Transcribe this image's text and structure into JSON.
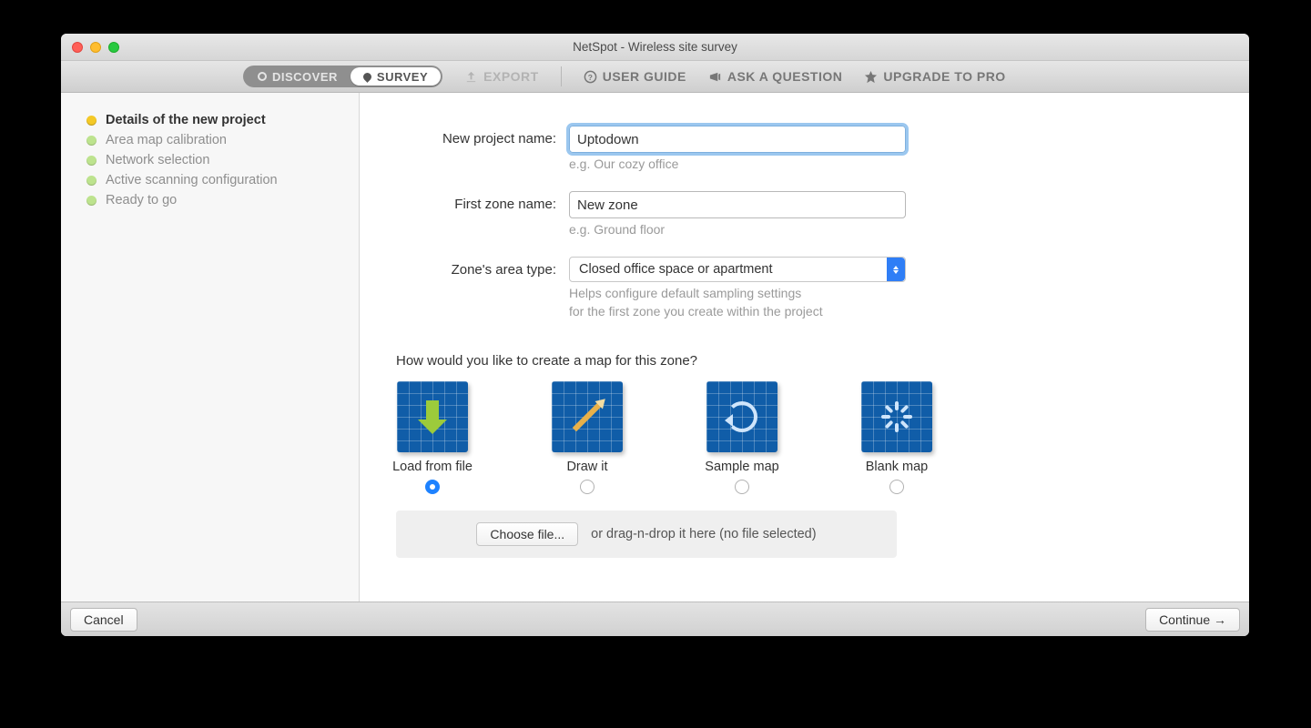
{
  "window": {
    "title": "NetSpot - Wireless site survey"
  },
  "toolbar": {
    "discover": "DISCOVER",
    "survey": "SURVEY",
    "export": "EXPORT",
    "user_guide": "USER GUIDE",
    "ask": "ASK A QUESTION",
    "upgrade": "UPGRADE TO PRO"
  },
  "sidebar": {
    "steps": [
      {
        "label": "Details of the new project",
        "state": "active"
      },
      {
        "label": "Area map calibration",
        "state": "pending"
      },
      {
        "label": "Network selection",
        "state": "pending"
      },
      {
        "label": "Active scanning configuration",
        "state": "pending"
      },
      {
        "label": "Ready to go",
        "state": "pending"
      }
    ]
  },
  "form": {
    "project_label": "New project name:",
    "project_value": "Uptodown",
    "project_hint": "e.g. Our cozy office",
    "zone_label": "First zone name:",
    "zone_value": "New zone",
    "zone_hint": "e.g. Ground floor",
    "area_label": "Zone's area type:",
    "area_value": "Closed office space or apartment",
    "area_hint1": "Helps configure default sampling settings",
    "area_hint2": "for the first zone you create within the project",
    "map_question": "How would you like to create a map for this zone?",
    "options": [
      {
        "label": "Load from file",
        "selected": true
      },
      {
        "label": "Draw it",
        "selected": false
      },
      {
        "label": "Sample map",
        "selected": false
      },
      {
        "label": "Blank map",
        "selected": false
      }
    ],
    "choose_file": "Choose file...",
    "drop_text": "or drag-n-drop it here (no file selected)"
  },
  "footer": {
    "cancel": "Cancel",
    "continue": "Continue →"
  }
}
